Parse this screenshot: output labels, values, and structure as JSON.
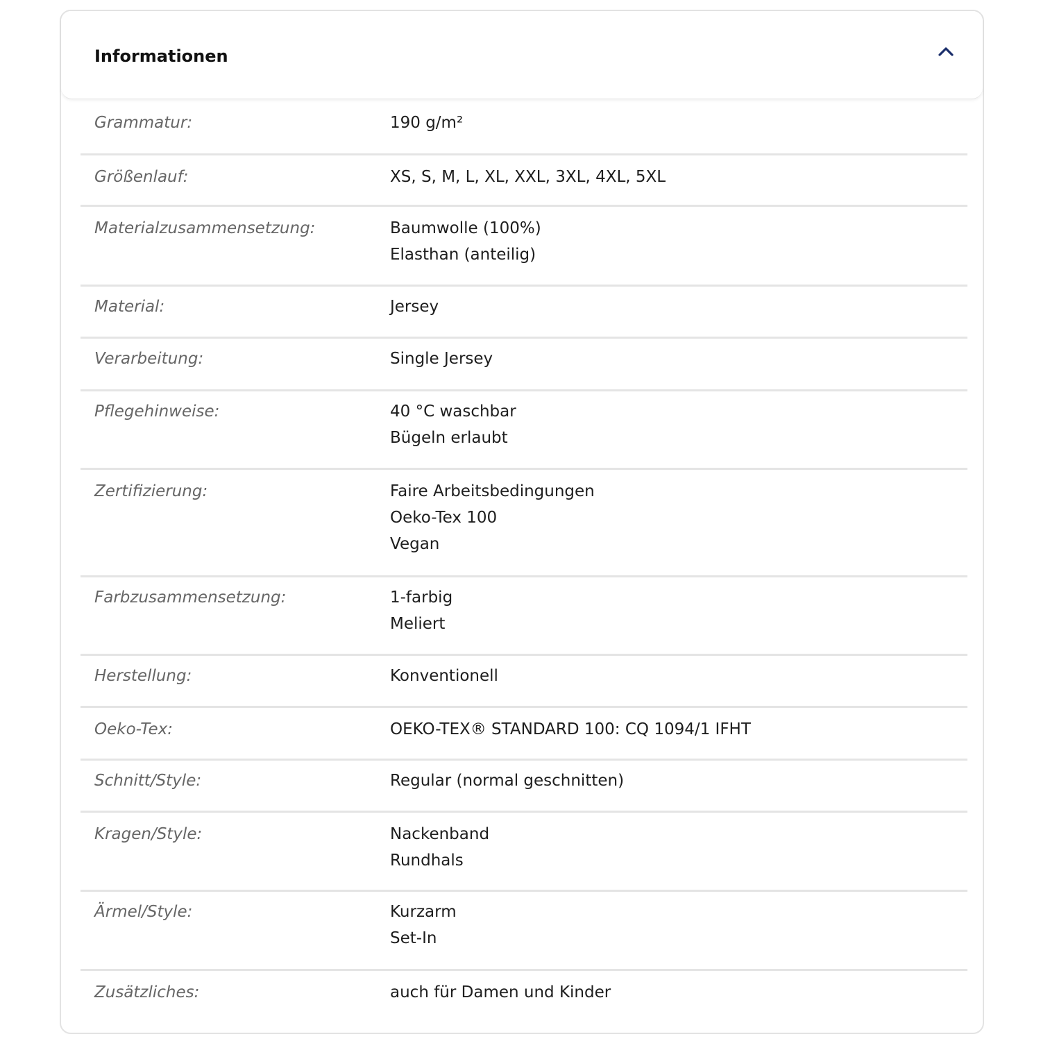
{
  "panel": {
    "title": "Informationen",
    "toggle_icon": "chevron-up-icon",
    "accent_color": "#1a2e6b"
  },
  "rows": [
    {
      "key": "grammatur",
      "label": "Grammatur:",
      "values": [
        "190 g/m²"
      ]
    },
    {
      "key": "groessenlauf",
      "label": "Größenlauf:",
      "values": [
        "XS, S, M, L, XL, XXL, 3XL, 4XL, 5XL"
      ]
    },
    {
      "key": "materialzusammensetzung",
      "label": "Materialzusammensetzung:",
      "values": [
        "Baumwolle (100%)",
        "Elasthan (anteilig)"
      ]
    },
    {
      "key": "material",
      "label": "Material:",
      "values": [
        "Jersey"
      ]
    },
    {
      "key": "verarbeitung",
      "label": "Verarbeitung:",
      "values": [
        "Single Jersey"
      ]
    },
    {
      "key": "pflegehinweise",
      "label": "Pflegehinweise:",
      "values": [
        "40 °C waschbar",
        "Bügeln erlaubt"
      ]
    },
    {
      "key": "zertifizierung",
      "label": "Zertifizierung:",
      "values": [
        "Faire Arbeitsbedingungen",
        "Oeko-Tex 100",
        "Vegan"
      ]
    },
    {
      "key": "farbzusammensetzung",
      "label": "Farbzusammensetzung:",
      "values": [
        "1-farbig",
        "Meliert"
      ]
    },
    {
      "key": "herstellung",
      "label": "Herstellung:",
      "values": [
        "Konventionell"
      ]
    },
    {
      "key": "oeko-tex",
      "label": "Oeko-Tex:",
      "values": [
        "OEKO-TEX® STANDARD 100: CQ 1094/1 IFHT"
      ]
    },
    {
      "key": "schnitt-style",
      "label": "Schnitt/Style:",
      "values": [
        "Regular (normal geschnitten)"
      ]
    },
    {
      "key": "kragen-style",
      "label": "Kragen/Style:",
      "values": [
        "Nackenband",
        "Rundhals"
      ]
    },
    {
      "key": "aermel-style",
      "label": "Ärmel/Style:",
      "values": [
        "Kurzarm",
        "Set-In"
      ]
    },
    {
      "key": "zusaetzliches",
      "label": "Zusätzliches:",
      "values": [
        "auch für Damen und Kinder"
      ]
    }
  ]
}
